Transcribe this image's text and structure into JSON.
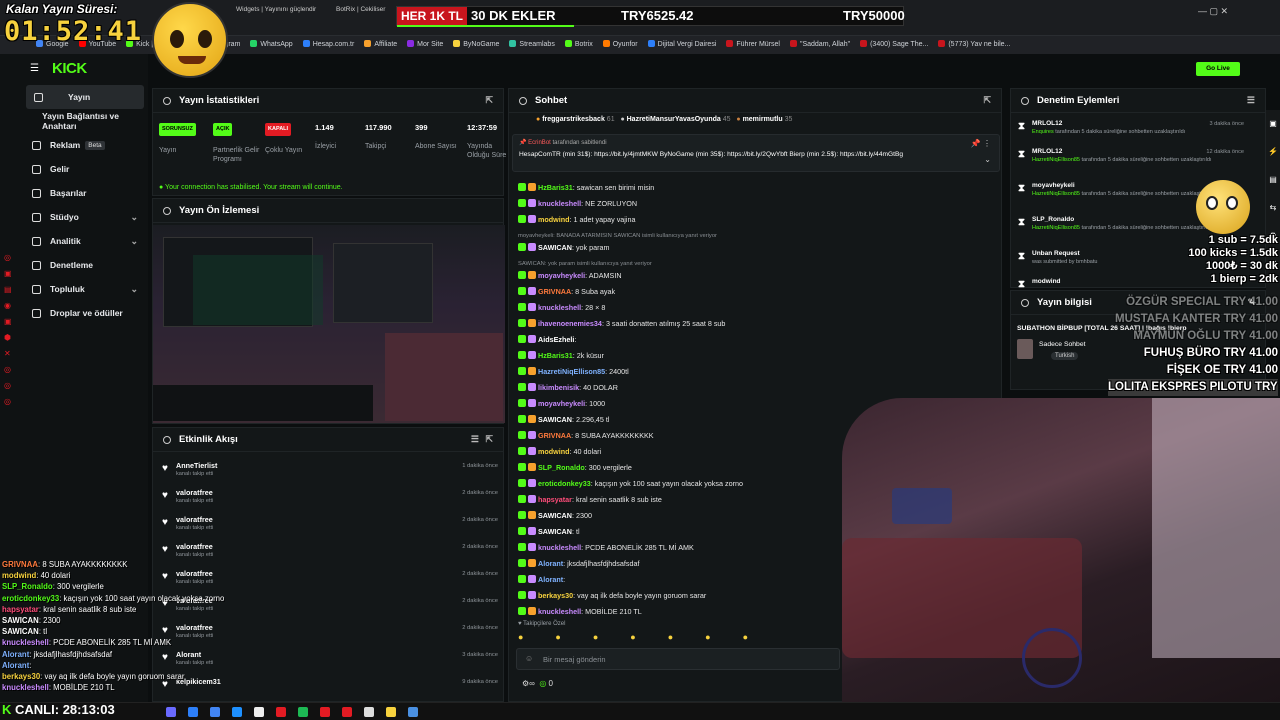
{
  "colors": {
    "accent": "#53fc18",
    "bg": "#0b0e0f",
    "panel": "#131718",
    "red": "#e31b23"
  },
  "overlay": {
    "timer_title": "Kalan Yayın Süresi:",
    "timer_value": "01:52:41",
    "ticker_red": "HER 1K TL",
    "ticker_main": "30 DK EKLER",
    "ticker_amount": "TRY6525.42",
    "ticker_goal": "TRY50000",
    "live_label": "CANLI:",
    "live_time": "28:13:03",
    "rates": [
      "1 sub = 7.5dk",
      "100 kicks = 1.5dk",
      "1000₺ = 30 dk",
      "1 bierp = 2dk"
    ],
    "donors": [
      {
        "name": "ÖZGÜR SPECIAL",
        "amount": "TRY 41.00"
      },
      {
        "name": "MUSTAFA KANTER",
        "amount": "TRY 41.00"
      },
      {
        "name": "MAYMUN OĞLU",
        "amount": "TRY 41.00"
      },
      {
        "name": "FUHUŞ BÜRO",
        "amount": "TRY 41.00"
      },
      {
        "name": "FİŞEK OE",
        "amount": "TRY 41.00"
      },
      {
        "name": "LOLITA EKSPRES PILOTU",
        "amount": "TRY 41.00"
      }
    ],
    "chat": [
      {
        "user": "GRIVNAA",
        "msg": "8 SUBA AYAKKKKKKKK",
        "color": "#ff7a3d"
      },
      {
        "user": "modwind",
        "msg": "40 dolari",
        "color": "#f7d23e"
      },
      {
        "user": "SLP_Ronaldo",
        "msg": "300 vergilerle",
        "color": "#53fc18"
      },
      {
        "user": "eroticdonkey33",
        "msg": "kaçışın yok 100 saat yayın olacak yoksa zorno",
        "color": "#53fc18"
      },
      {
        "user": "hapsyatar",
        "msg": "kral senin saatlik 8 sub iste",
        "color": "#ff4d7a"
      },
      {
        "user": "SAWICAN",
        "msg": "2300",
        "color": "#ffffff"
      },
      {
        "user": "SAWICAN",
        "msg": "tl",
        "color": "#ffffff"
      },
      {
        "user": "knuckleshell",
        "msg": "PCDE ABONELİK 285 TL Mİ AMK",
        "color": "#c98bff"
      },
      {
        "user": "Alorant",
        "msg": "jksdafjlhasfdjhdsafsdaf",
        "color": "#7fb2ff"
      },
      {
        "user": "Alorant",
        "msg": "",
        "color": "#7fb2ff"
      },
      {
        "user": "berkays30",
        "msg": "vay aq ilk defa boyle yayın goruom sarar",
        "color": "#f7d23e"
      },
      {
        "user": "knuckleshell",
        "msg": "MOBİLDE 210 TL",
        "color": "#c98bff"
      }
    ]
  },
  "browser": {
    "tabs": [
      "Widgets | Yayınını güçlendir",
      "BotRix | Cekiliser"
    ],
    "bookmarks": [
      "Google",
      "YouTube",
      "Kick | Dashboard",
      "Instagram",
      "WhatsApp",
      "Hesap.com.tr",
      "Affiliate",
      "Mor Site",
      "ByNoGame",
      "Streamlabs",
      "Botrix",
      "Oyunfor",
      "Dijital Vergi Dairesi",
      "Führer Mürsel",
      "\"Saddam, Allah\"",
      "(3400) Sage The...",
      "(5773) Yav ne bile..."
    ]
  },
  "sidebar": {
    "logo": "KICK",
    "items": [
      {
        "label": "Yayın"
      },
      {
        "label": "Yayın Bağlantısı ve Anahtarı"
      },
      {
        "label": "Reklam",
        "badge": "Beta"
      },
      {
        "label": "Gelir"
      },
      {
        "label": "Başarılar"
      },
      {
        "label": "Stüdyo"
      },
      {
        "label": "Analitik"
      },
      {
        "label": "Denetleme"
      },
      {
        "label": "Topluluk"
      },
      {
        "label": "Droplar ve ödüller"
      }
    ]
  },
  "stats": {
    "title": "Yayın İstatistikleri",
    "items": [
      {
        "badge": "SORUNSUZ",
        "label": "Yayın"
      },
      {
        "badge": "AÇIK",
        "label": "Partnerlik Gelir Programı"
      },
      {
        "badge": "KAPALI",
        "label": "Çoklu Yayın"
      },
      {
        "value": "1.149",
        "label": "İzleyici"
      },
      {
        "value": "117.990",
        "label": "Takipçi"
      },
      {
        "value": "399",
        "label": "Abone Sayısı"
      },
      {
        "value": "12:37:59",
        "label": "Yayında Olduğu Süre"
      }
    ],
    "notice": "Your connection has stabilised. Your stream will continue."
  },
  "preview": {
    "title": "Yayın Ön İzlemesi"
  },
  "events": {
    "title": "Etkinlik Akışı",
    "items": [
      {
        "name": "AnneTierlist",
        "sub": "kanalı takip etti",
        "time": "1 dakika önce"
      },
      {
        "name": "valoratfree",
        "sub": "kanalı takip etti",
        "time": "2 dakika önce"
      },
      {
        "name": "valoratfree",
        "sub": "kanalı takip etti",
        "time": "2 dakika önce"
      },
      {
        "name": "valoratfree",
        "sub": "kanalı takip etti",
        "time": "2 dakika önce"
      },
      {
        "name": "valoratfree",
        "sub": "kanalı takip etti",
        "time": "2 dakika önce"
      },
      {
        "name": "valoratfree",
        "sub": "kanalı takip etti",
        "time": "2 dakika önce"
      },
      {
        "name": "valoratfree",
        "sub": "kanalı takip etti",
        "time": "2 dakika önce"
      },
      {
        "name": "Alorant",
        "sub": "kanalı takip etti",
        "time": "3 dakika önce"
      },
      {
        "name": "kelpikicem31",
        "sub": "",
        "time": "9 dakika önce"
      }
    ]
  },
  "chat": {
    "title": "Sohbet",
    "top": [
      {
        "name": "freggarstrikesback",
        "n": "61"
      },
      {
        "name": "HazretiMansurYavasOyunda",
        "n": "45"
      },
      {
        "name": "memirmutlu",
        "n": "35"
      }
    ],
    "pinned_by": "tarafından sabitlendi",
    "pinned_user": "EcrinBot",
    "pinned_text": "HesapComTR (min 31$): https://bit.ly/4jmtMKW ByNoGame (min 35$): https://bit.ly/2QwYbft Bierp (min 2.5$): https://bit.ly/44mGtBg",
    "lines": [
      {
        "user": "HzBaris31",
        "msg": "sawican sen birimi misin",
        "color": "#53fc18"
      },
      {
        "user": "knuckleshell",
        "msg": "NE ZORLUYON",
        "color": "#c98bff"
      },
      {
        "user": "modwind",
        "msg": "1 adet yapay vajina",
        "color": "#f7d23e"
      },
      {
        "sys": "moyavheykeli: BANADA ATARMISIN SAWICAN isimli kullanıcıya yanıt veriyor"
      },
      {
        "user": "SAWICAN",
        "msg": "yok param",
        "color": "#ffffff"
      },
      {
        "sys": "SAWICAN: yok param isimli kullanıcıya yanıt veriyor"
      },
      {
        "user": "moyavheykeli",
        "msg": "ADAMSIN",
        "color": "#c98bff"
      },
      {
        "user": "GRIVNAA",
        "msg": "8 Suba ayak",
        "color": "#ff7a3d"
      },
      {
        "user": "knuckleshell",
        "msg": "28 × 8",
        "color": "#c98bff"
      },
      {
        "user": "ihavenoenemies34",
        "msg": "3 saati donatten atılmış 25 saat 8 sub",
        "color": "#c98bff"
      },
      {
        "user": "AidsEzheli",
        "msg": "",
        "color": "#ffffff"
      },
      {
        "user": "HzBaris31",
        "msg": "2k küsur",
        "color": "#53fc18"
      },
      {
        "user": "HazretiNiqEllison85",
        "msg": "2400tl",
        "color": "#7fb2ff"
      },
      {
        "user": "likimbenisik",
        "msg": "40 DOLAR",
        "color": "#c98bff"
      },
      {
        "user": "moyavheykeli",
        "msg": "1000",
        "color": "#c98bff"
      },
      {
        "user": "SAWICAN",
        "msg": "2.296,45 tl",
        "color": "#ffffff"
      },
      {
        "user": "GRIVNAA",
        "msg": "8 SUBA AYAKKKKKKKK",
        "color": "#ff7a3d"
      },
      {
        "user": "modwind",
        "msg": "40 dolari",
        "color": "#f7d23e"
      },
      {
        "user": "SLP_Ronaldo",
        "msg": "300 vergilerle",
        "color": "#53fc18"
      },
      {
        "user": "eroticdonkey33",
        "msg": "kaçışın yok 100 saat yayın olacak yoksa zorno",
        "color": "#53fc18"
      },
      {
        "user": "hapsyatar",
        "msg": "kral senin saatlik 8 sub iste",
        "color": "#ff4d7a"
      },
      {
        "user": "SAWICAN",
        "msg": "2300",
        "color": "#ffffff"
      },
      {
        "user": "SAWICAN",
        "msg": "tl",
        "color": "#ffffff"
      },
      {
        "user": "knuckleshell",
        "msg": "PCDE ABONELİK 285 TL Mİ AMK",
        "color": "#c98bff"
      },
      {
        "user": "Alorant",
        "msg": "jksdafjlhasfdjhdsafsdaf",
        "color": "#7fb2ff"
      },
      {
        "user": "Alorant",
        "msg": "",
        "color": "#7fb2ff"
      },
      {
        "user": "berkays30",
        "msg": "vay aq ilk defa boyle yayın goruom sarar",
        "color": "#f7d23e"
      },
      {
        "user": "knuckleshell",
        "msg": "MOBİLDE 210 TL",
        "color": "#c98bff"
      }
    ],
    "emote_tab": "Takipçilere Özel",
    "input_placeholder": "Bir mesaj gönderin",
    "points": "0"
  },
  "moderation": {
    "title": "Denetim Eylemleri",
    "items": [
      {
        "name": "MRLOL12",
        "by": "Enquires",
        "desc": "tarafından 5 dakika süreliğine sohbetten uzaklaştırıldı",
        "time": "3 dakika önce"
      },
      {
        "name": "MRLOL12",
        "by": "HazretiNiqEllison85",
        "desc": "tarafından 5 dakika süreliğine sohbetten uzaklaştırıldı",
        "time": "12 dakika önce"
      },
      {
        "name": "moyavheykeli",
        "by": "HazretiNiqEllison85",
        "desc": "tarafından 5 dakika süreliğine sohbetten uzaklaştırıldı",
        "time": ""
      },
      {
        "name": "SLP_Ronaldo",
        "by": "HazretiNiqEllison85",
        "desc": "tarafından 5 dakika süreliğine sohbetten uzaklaştırıldı",
        "time": ""
      },
      {
        "name": "Unban Request",
        "by": "",
        "desc": "was submitted by bmhbatu",
        "time": ""
      },
      {
        "name": "modwind",
        "by": "",
        "desc": "",
        "time": ""
      }
    ]
  },
  "info": {
    "title": "Yayın bilgisi",
    "stream_title": "SUBATHON BİPBUP [TOTAL 26 SAAT] | !bağış !bierp",
    "category": "Sadece Sohbet",
    "tag": "Turkish"
  }
}
